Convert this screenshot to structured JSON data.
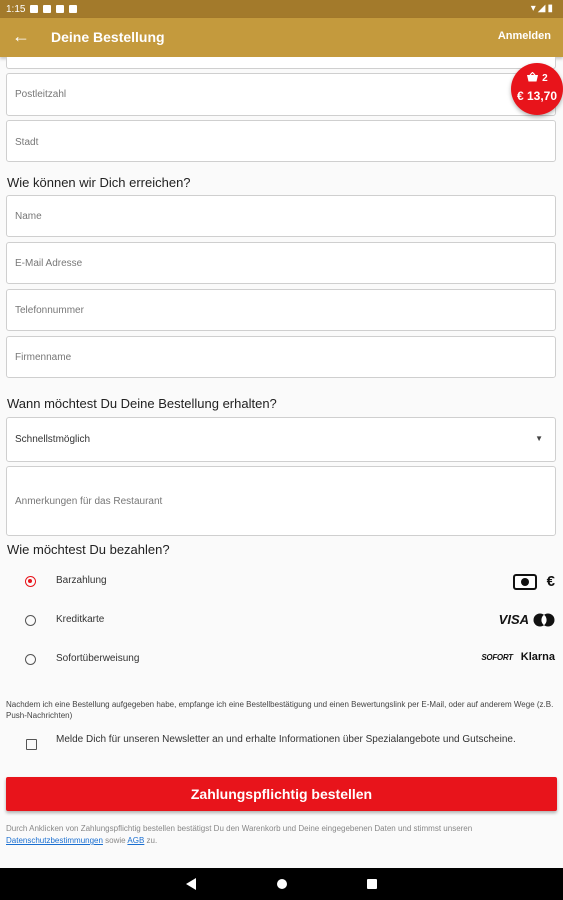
{
  "status": {
    "time": "1:15"
  },
  "appbar": {
    "back_icon": "arrow-left-icon",
    "title": "Deine Bestellung",
    "login": "Anmelden"
  },
  "cart": {
    "count": "2",
    "price": "€ 13,70",
    "color": "#e8141b"
  },
  "address": {
    "zip_placeholder": "Postleitzahl",
    "city_placeholder": "Stadt"
  },
  "contact": {
    "heading": "Wie können wir Dich erreichen?",
    "name": "Name",
    "email": "E-Mail Adresse",
    "phone": "Telefonnummer",
    "company": "Firmenname"
  },
  "delivery": {
    "heading": "Wann möchtest Du Deine Bestellung erhalten?",
    "time_selected": "Schnellstmöglich",
    "remarks": "Anmerkungen für das Restaurant"
  },
  "payment": {
    "heading": "Wie möchtest Du bezahlen?",
    "options": [
      {
        "label": "Barzahlung",
        "selected": true,
        "icons": [
          "cash-icon",
          "euro-icon"
        ]
      },
      {
        "label": "Kreditkarte",
        "selected": false,
        "icons": [
          "visa-icon",
          "mastercard-icon"
        ]
      },
      {
        "label": "Sofortüberweisung",
        "selected": false,
        "icons": [
          "sofort-icon",
          "klarna-icon"
        ]
      }
    ],
    "visa": "VISA",
    "sofort": "SOFORT",
    "klarna": "Klarna",
    "euro": "€"
  },
  "notice": "Nachdem ich eine Bestellung aufgegeben habe, empfange ich eine Bestellbestätigung und einen Bewertungslink per E-Mail, oder auf anderem Wege (z.B. Push-Nachrichten)",
  "newsletter": "Melde Dich für unseren Newsletter an und erhalte Informationen über Spezialangebote und Gutscheine.",
  "order_button": "Zahlungspflichtig bestellen",
  "footer": {
    "text_before": "Durch Anklicken von Zahlungspflichtig bestellen bestätigst Du den Warenkorb und Deine eingegebenen Daten und stimmst unseren ",
    "privacy_link": "Datenschutzbestimmungen",
    "text_middle": " sowie ",
    "terms_link": "AGB",
    "text_after": " zu."
  },
  "colors": {
    "accent": "#c49a3d",
    "primary": "#e8141b",
    "link": "#1a6fd1"
  }
}
